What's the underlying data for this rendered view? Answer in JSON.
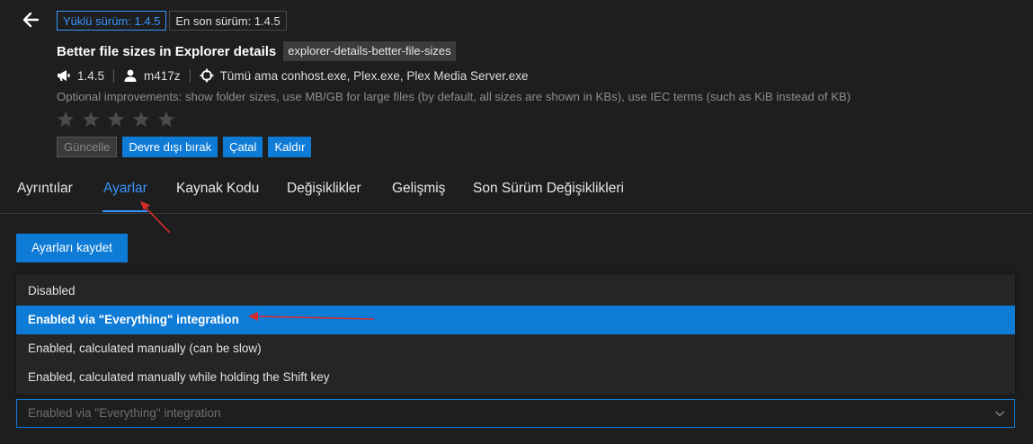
{
  "header": {
    "installed_version_badge": "Yüklü sürüm: 1.4.5",
    "latest_version_badge": "En son sürüm: 1.4.5",
    "title": "Better file sizes in Explorer details",
    "mod_id": "explorer-details-better-file-sizes",
    "version": "1.4.5",
    "author": "m417z",
    "targets": "Tümü ama conhost.exe, Plex.exe, Plex Media Server.exe",
    "description": "Optional improvements: show folder sizes, use MB/GB for large files (by default, all sizes are shown in KBs), use IEC terms (such as KiB instead of KB)",
    "rating_stars": 0,
    "rating_max": 5
  },
  "actions": {
    "update": "Güncelle",
    "disable": "Devre dışı bırak",
    "fork": "Çatal",
    "remove": "Kaldır"
  },
  "tabs": [
    {
      "label": "Ayrıntılar"
    },
    {
      "label": "Ayarlar"
    },
    {
      "label": "Kaynak Kodu"
    },
    {
      "label": "Değişiklikler"
    },
    {
      "label": "Gelişmiş"
    },
    {
      "label": "Son Sürüm Değişiklikleri"
    }
  ],
  "active_tab": "Ayarlar",
  "settings": {
    "save_button": "Ayarları kaydet",
    "options": [
      {
        "label": "Disabled"
      },
      {
        "label": "Enabled via \"Everything\" integration"
      },
      {
        "label": "Enabled, calculated manually (can be slow)"
      },
      {
        "label": "Enabled, calculated manually while holding the Shift key"
      }
    ],
    "selected_value": "Enabled via \"Everything\" integration"
  },
  "icons": {
    "back": "arrow-left-icon",
    "version": "megaphone-icon",
    "author": "person-icon",
    "targets": "crosshair-icon",
    "star": "star-icon",
    "dropdown": "chevron-down-icon"
  },
  "colors": {
    "accent": "#0e7bd6",
    "link": "#3794ff",
    "background": "#1e1e1e",
    "annotation_arrow": "#d62c2c"
  }
}
